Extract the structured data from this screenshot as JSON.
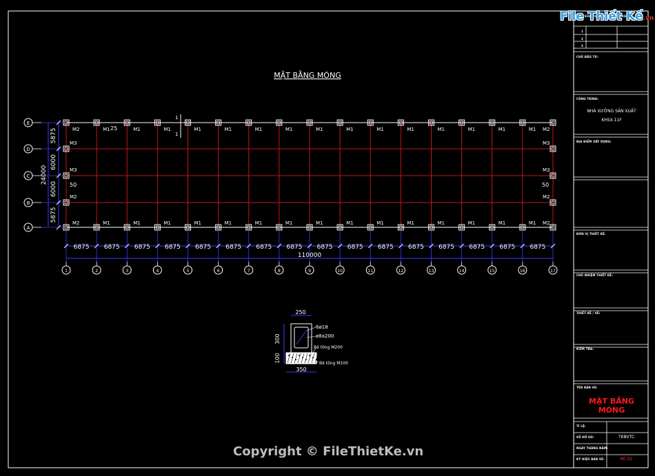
{
  "drawing": {
    "title": "MẶT BẰNG MÓNG",
    "total_width": "110000",
    "total_height": "24000",
    "col_spacing": "6875",
    "row_spacings": [
      "5875",
      "6000",
      "6000",
      "5875"
    ],
    "col_axes": [
      "1",
      "2",
      "3",
      "4",
      "5",
      "6",
      "7",
      "8",
      "9",
      "10",
      "11",
      "12",
      "13",
      "14",
      "15",
      "16",
      "17"
    ],
    "row_axes": [
      "E",
      "D",
      "C",
      "B",
      "A"
    ],
    "section_mark": "1",
    "dim_25": "25",
    "dim_50": "50",
    "foundation_labels": {
      "corner": "M2",
      "edge": "M1",
      "side": "M3"
    }
  },
  "section": {
    "width_top": "250",
    "height_col": "300",
    "height_base": "100",
    "width_base": "350",
    "rebar_main": "6ø18",
    "rebar_stirrup": "ø8a200",
    "concrete1": "Bê tông M200",
    "concrete2": "Bê tông M100"
  },
  "title_block": {
    "rev_rows": [
      "1",
      "2",
      "3"
    ],
    "header_text": "ĐỢT SỬA THAY ĐỔI NỘI DUNG",
    "chu_dau_tu": "CHỦ ĐẦU TƯ:",
    "cong_trinh": "CÔNG TRÌNH:",
    "project_name": "NHÀ XƯỞNG SẢN XUẤT",
    "project_code": "KHSX.11F",
    "dia_diem": "ĐỊA ĐIỂM XÂY DỰNG:",
    "don_vi": "ĐƠN VỊ THIẾT KẾ:",
    "chu_nhiem": "CHỦ NHIỆM THIẾT KẾ:",
    "thiet_ke": "THIẾT KẾ / VẼ:",
    "kiem_tra": "KIỂM TRA:",
    "ten_ban_ve": "TÊN BẢN VẼ:",
    "sheet_title": "MẶT BẰNG MÓNG",
    "ti_le": "TỈ LỆ:",
    "so_ho_so": "SỐ HỒ SƠ:",
    "so_ho_so_val": "TKBVTC",
    "ngay": "NGÀY THÁNG NĂM:",
    "ky_hieu": "KÝ HIỆU BẢN VẼ:",
    "ky_hieu_val": "KC-01"
  },
  "watermark": {
    "logo": "File Thiết Kế",
    "logo_suffix": ".vn",
    "copyright": "Copyright © FileThietKe.vn"
  },
  "colors": {
    "grid": "#c01818",
    "column": "#ffffff",
    "dim": "#3a3aff",
    "text": "#ffffff",
    "accent": "#ff1a1a"
  }
}
